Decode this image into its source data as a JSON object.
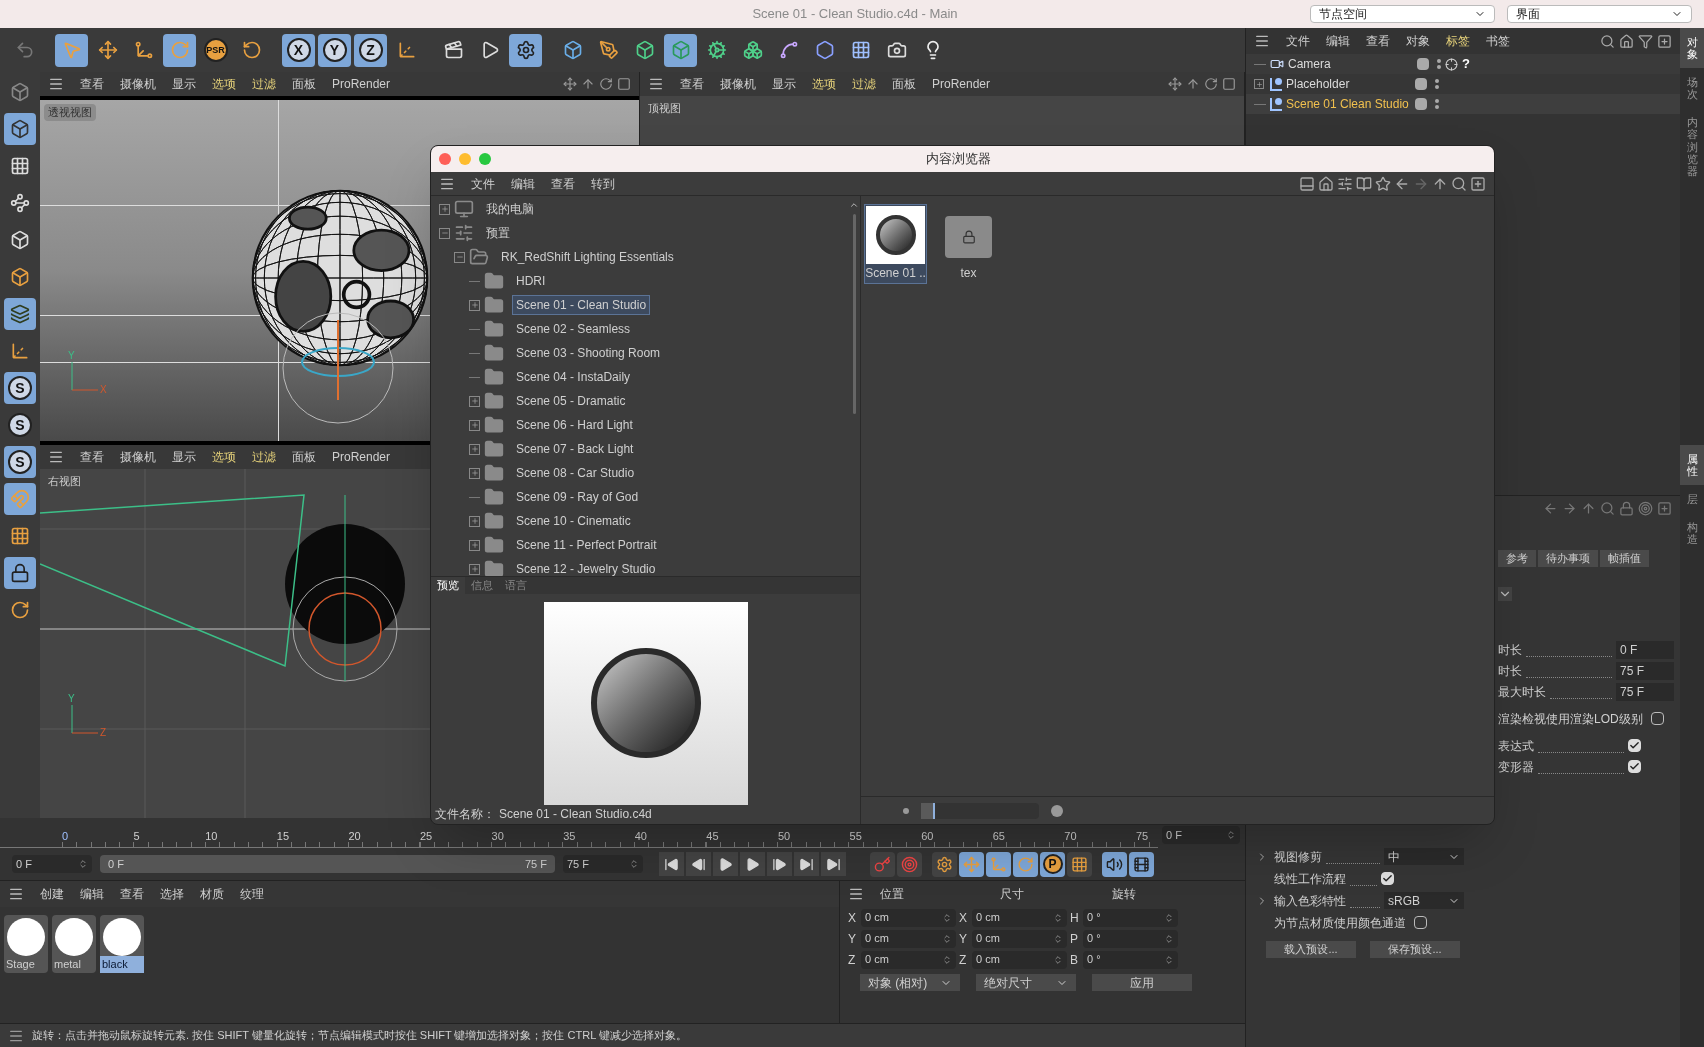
{
  "window": {
    "title": "Scene 01 - Clean Studio.c4d - Main",
    "layout_dropdowns": [
      "节点空间",
      "界面"
    ]
  },
  "toolbar": [
    {
      "selected": false
    },
    {
      "selected": true
    },
    {
      "selected": false
    },
    {
      "selected": false
    },
    {
      "selected": true
    },
    {
      "label": "PSR",
      "selected": false
    },
    {
      "selected": false
    },
    {
      "label": "X",
      "selected": true
    },
    {
      "label": "Y",
      "selected": true
    },
    {
      "label": "Z",
      "selected": true
    },
    {
      "selected": false
    },
    {
      "selected": false
    },
    {
      "selected": false
    },
    {
      "selected": true
    },
    {
      "selected": false
    },
    {
      "selected": false
    },
    {
      "selected": false
    },
    {
      "selected": true
    },
    {
      "selected": false
    },
    {
      "selected": false
    },
    {
      "selected": false
    },
    {
      "selected": false
    },
    {
      "selected": false
    },
    {
      "selected": false
    },
    {
      "selected": false
    }
  ],
  "left_tools": [
    {
      "selected": false
    },
    {
      "selected": true
    },
    {
      "selected": false
    },
    {
      "selected": false
    },
    {
      "selected": false
    },
    {
      "selected": false
    },
    {
      "selected": true
    },
    {
      "selected": false
    },
    {
      "label": "S",
      "selected": true
    },
    {
      "label": "S",
      "selected": false
    },
    {
      "label": "S",
      "selected": true
    },
    {
      "selected": true
    },
    {
      "selected": false
    },
    {
      "selected": true
    },
    {
      "selected": false
    }
  ],
  "viewports": [
    {
      "label": "透视视图",
      "menu": [
        {
          "label": "查看",
          "highlighted": false
        },
        {
          "label": "摄像机",
          "highlighted": false
        },
        {
          "label": "显示",
          "highlighted": false
        },
        {
          "label": "选项",
          "highlighted": true
        },
        {
          "label": "过滤",
          "highlighted": true
        },
        {
          "label": "面板",
          "highlighted": false
        },
        {
          "label": "ProRender",
          "highlighted": false
        }
      ],
      "axes": [
        "Y",
        "X"
      ]
    },
    {
      "label": "顶视图",
      "menu": [
        {
          "label": "查看",
          "highlighted": false
        },
        {
          "label": "摄像机",
          "highlighted": false
        },
        {
          "label": "显示",
          "highlighted": false
        },
        {
          "label": "选项",
          "highlighted": true
        },
        {
          "label": "过滤",
          "highlighted": true
        },
        {
          "label": "面板",
          "highlighted": false
        },
        {
          "label": "ProRender",
          "highlighted": false
        }
      ]
    },
    {
      "label": "右视图",
      "menu": [
        {
          "label": "查看",
          "highlighted": false
        },
        {
          "label": "摄像机",
          "highlighted": false
        },
        {
          "label": "显示",
          "highlighted": false
        },
        {
          "label": "选项",
          "highlighted": true
        },
        {
          "label": "过滤",
          "highlighted": true
        },
        {
          "label": "面板",
          "highlighted": false
        },
        {
          "label": "ProRender",
          "highlighted": false
        }
      ],
      "axes": [
        "Y",
        "Z"
      ]
    }
  ],
  "timeline": {
    "ruler": [
      "0",
      "5",
      "10",
      "15",
      "20",
      "25",
      "30",
      "35",
      "40",
      "45",
      "50",
      "55",
      "60",
      "65",
      "70",
      "75"
    ],
    "current_frame": "0 F",
    "start": "0 F",
    "range_start": "0 F",
    "range_end": "75 F",
    "end": "75 F",
    "keys": [
      {
        "selected": false
      },
      {
        "selected": false
      },
      {
        "selected": false
      },
      {
        "selected": true
      },
      {
        "selected": true
      },
      {
        "selected": true
      },
      {
        "label": "P",
        "selected": true
      },
      {
        "selected": false
      },
      {
        "selected": true
      },
      {
        "selected": true
      }
    ]
  },
  "materials": {
    "menu": [
      "创建",
      "编辑",
      "查看",
      "选择",
      "材质",
      "纹理"
    ],
    "items": [
      {
        "name": "Stage",
        "selected": false
      },
      {
        "name": "metal",
        "selected": false
      },
      {
        "name": "black",
        "selected": true
      }
    ]
  },
  "coordinates": {
    "headers": [
      "位置",
      "尺寸",
      "旋转"
    ],
    "rows": [
      {
        "axis": "X",
        "position": "0 cm",
        "size_axis": "X",
        "size": "0 cm",
        "rotation_axis": "H",
        "rotation": "0 °"
      },
      {
        "axis": "Y",
        "position": "0 cm",
        "size_axis": "Y",
        "size": "0 cm",
        "rotation_axis": "P",
        "rotation": "0 °"
      },
      {
        "axis": "Z",
        "position": "0 cm",
        "size_axis": "Z",
        "size": "0 cm",
        "rotation_axis": "B",
        "rotation": "0 °"
      }
    ],
    "mode": "对象 (相对)",
    "size_mode": "绝对尺寸",
    "apply": "应用"
  },
  "status_bar": "旋转：点击并拖动鼠标旋转元素. 按住 SHIFT 键量化旋转；节点编辑模式时按住 SHIFT 键增加选择对象；按住 CTRL 键减少选择对象。",
  "object_manager": {
    "menu": [
      {
        "label": "文件",
        "highlighted": false
      },
      {
        "label": "编辑",
        "highlighted": false
      },
      {
        "label": "查看",
        "highlighted": false
      },
      {
        "label": "对象",
        "highlighted": false
      },
      {
        "label": "标签",
        "highlighted": true
      },
      {
        "label": "书签",
        "highlighted": false
      }
    ],
    "objects": [
      {
        "name": "Camera",
        "kind": "camera",
        "selected": false,
        "tag": "?"
      },
      {
        "name": "Placeholder",
        "kind": "null",
        "expanded": false,
        "selected": false
      },
      {
        "name": "Scene 01 Clean Studio",
        "kind": "null",
        "selected": true
      }
    ]
  },
  "side_tabs_top": [
    {
      "label": "对象",
      "selected": true
    },
    {
      "label": "场次",
      "selected": false
    },
    {
      "label": "内容浏览器",
      "selected": false
    }
  ],
  "attributes": {
    "tabs": [
      {
        "label": "参考",
        "selected": false
      },
      {
        "label": "待办事项",
        "selected": false
      },
      {
        "label": "帧插值",
        "selected": false
      }
    ],
    "rows": [
      {
        "kind": "value",
        "label": "时长",
        "value": "0 F"
      },
      {
        "kind": "value",
        "label": "时长",
        "value": "75 F"
      },
      {
        "kind": "value",
        "label": "最大时长",
        "value": "75 F"
      },
      {
        "kind": "check",
        "label": "渲染检视使用渲染LOD级别",
        "checked": false
      },
      {
        "kind": "check",
        "label": "表达式",
        "checked": true
      },
      {
        "kind": "check",
        "label": "变形器",
        "checked": true
      }
    ],
    "lower_rows": [
      {
        "kind": "select",
        "label": "视图修剪",
        "value": "中"
      },
      {
        "kind": "check",
        "label": "线性工作流程",
        "checked": true
      },
      {
        "kind": "select",
        "label": "输入色彩特性",
        "value": "sRGB"
      },
      {
        "kind": "check",
        "label": "为节点材质使用颜色通道",
        "checked": false
      }
    ],
    "buttons": [
      "载入预设...",
      "保存预设..."
    ]
  },
  "side_tabs_bottom": [
    {
      "label": "属性",
      "selected": true
    },
    {
      "label": "层",
      "selected": false
    },
    {
      "label": "构造",
      "selected": false
    }
  ],
  "content_browser": {
    "title": "内容浏览器",
    "menu": [
      "文件",
      "编辑",
      "查看",
      "转到"
    ],
    "tree": [
      {
        "name": "我的电脑",
        "kind": "computer",
        "expanded": false,
        "selected": false
      },
      {
        "name": "预置",
        "kind": "presets",
        "expanded": true,
        "selected": false,
        "children": [
          {
            "name": "RK_RedShift Lighting Essentials",
            "kind": "open-folder",
            "expanded": true,
            "selected": false,
            "children": [
              {
                "name": "HDRI",
                "kind": "folder",
                "selected": false
              },
              {
                "name": "Scene 01 - Clean Studio",
                "kind": "folder",
                "expanded": false,
                "selected": true
              },
              {
                "name": "Scene 02 - Seamless",
                "kind": "folder",
                "selected": false
              },
              {
                "name": "Scene 03 - Shooting Room",
                "kind": "folder",
                "selected": false
              },
              {
                "name": "Scene 04 - InstaDaily",
                "kind": "folder",
                "selected": false
              },
              {
                "name": "Scene 05 - Dramatic",
                "kind": "folder",
                "expanded": false,
                "selected": false
              },
              {
                "name": "Scene 06 - Hard Light",
                "kind": "folder",
                "expanded": false,
                "selected": false
              },
              {
                "name": "Scene 07 - Back Light",
                "kind": "folder",
                "expanded": false,
                "selected": false
              },
              {
                "name": "Scene 08 - Car Studio",
                "kind": "folder",
                "expanded": false,
                "selected": false
              },
              {
                "name": "Scene 09 - Ray of God",
                "kind": "folder",
                "selected": false
              },
              {
                "name": "Scene 10 - Cinematic",
                "kind": "folder",
                "expanded": false,
                "selected": false
              },
              {
                "name": "Scene 11 - Perfect Portrait",
                "kind": "folder",
                "expanded": false,
                "selected": false
              },
              {
                "name": "Scene 12 - Jewelry Studio",
                "kind": "folder",
                "expanded": false,
                "selected": false
              }
            ]
          }
        ]
      }
    ],
    "preview_tabs": [
      {
        "label": "预览",
        "selected": true
      },
      {
        "label": "信息",
        "selected": false
      },
      {
        "label": "语言",
        "selected": false
      }
    ],
    "file_name_label": "文件名称：",
    "file_name": "Scene 01 - Clean Studio.c4d",
    "items": [
      {
        "name": "Scene 01 ..",
        "kind": "scene",
        "selected": true
      },
      {
        "name": "tex",
        "kind": "folder",
        "selected": false
      }
    ],
    "thumb_size": {
      "level": 0.12
    }
  }
}
